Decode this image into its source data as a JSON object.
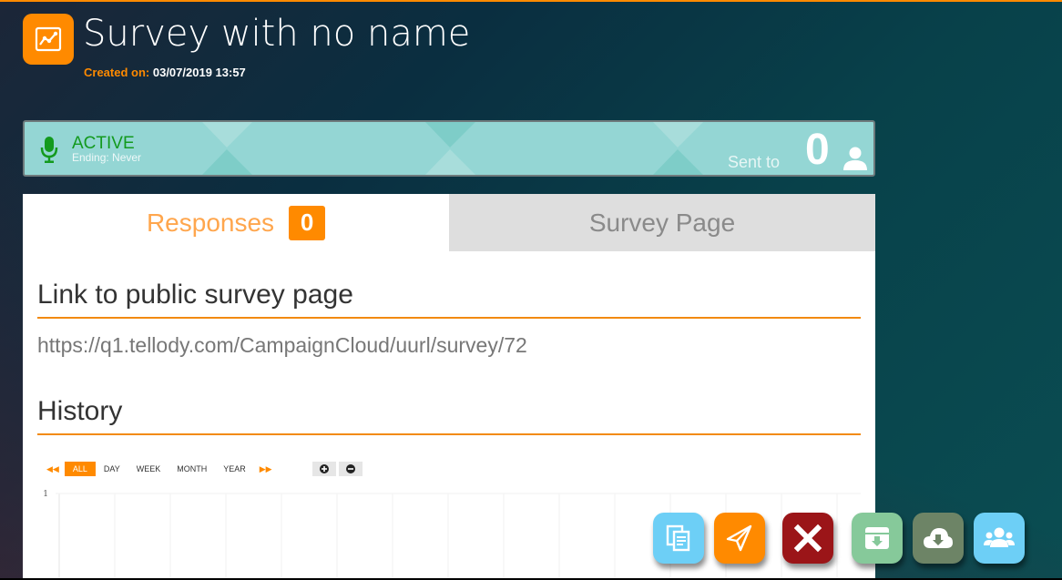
{
  "header": {
    "title": "Survey with no name",
    "created_label": "Created on:",
    "created_value": "03/07/2019 13:57",
    "app_icon": "line-chart-icon"
  },
  "status": {
    "state": "ACTIVE",
    "ending": "Ending: Never",
    "sent_label": "Sent to",
    "sent_count": "0",
    "icons": [
      "microphone-icon",
      "user-icon"
    ]
  },
  "tabs": [
    {
      "label": "Responses",
      "badge": "0",
      "active": true
    },
    {
      "label": "Survey Page",
      "active": false
    }
  ],
  "link_section": {
    "title": "Link to public survey page",
    "url": "https://q1.tellody.com/CampaignCloud/uurl/survey/72"
  },
  "history_section": {
    "title": "History",
    "range_buttons": [
      "ALL",
      "DAY",
      "WEEK",
      "MONTH",
      "YEAR"
    ],
    "active_range": "ALL",
    "prev_icon": "double-left-arrow-icon",
    "next_icon": "double-right-arrow-icon",
    "zoom_in_icon": "plus-circle-icon",
    "zoom_out_icon": "minus-circle-icon"
  },
  "chart_data": {
    "type": "line",
    "title": "",
    "xlabel": "",
    "ylabel": "",
    "y_ticks": [
      "1"
    ],
    "ylim": [
      0,
      1
    ],
    "series": [],
    "grid": true
  },
  "actions": [
    {
      "name": "copy-button",
      "icon": "copy-icon",
      "color": "#6dcff6"
    },
    {
      "name": "send-button",
      "icon": "paper-plane-icon",
      "color": "#ff8a00"
    },
    {
      "name": "delete-button",
      "icon": "close-icon",
      "color": "#9b1518"
    },
    {
      "name": "archive-button",
      "icon": "archive-download-icon",
      "color": "#86c99a"
    },
    {
      "name": "cloud-download-button",
      "icon": "cloud-download-icon",
      "color": "#6d8466"
    },
    {
      "name": "audience-button",
      "icon": "users-icon",
      "color": "#6dcff6"
    }
  ],
  "colors": {
    "accent": "#ff8a00",
    "status_panel": "#94d6d4",
    "active_green": "#139a1e"
  }
}
